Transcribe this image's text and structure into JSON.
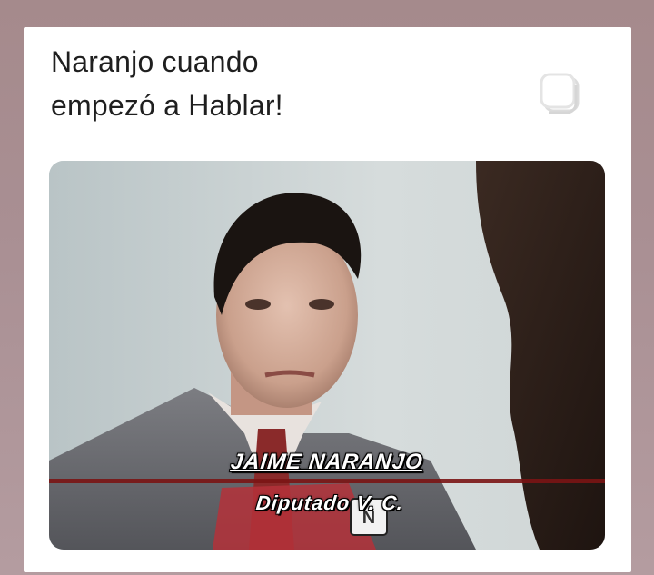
{
  "post": {
    "text_line_1": "Naranjo cuando",
    "text_line_2": "empezó a Hablar!"
  },
  "icons": {
    "carousel": "multiple-images-icon"
  },
  "video_caption": {
    "name": "JAIME NARANJO",
    "role": "Diputado V. C."
  }
}
